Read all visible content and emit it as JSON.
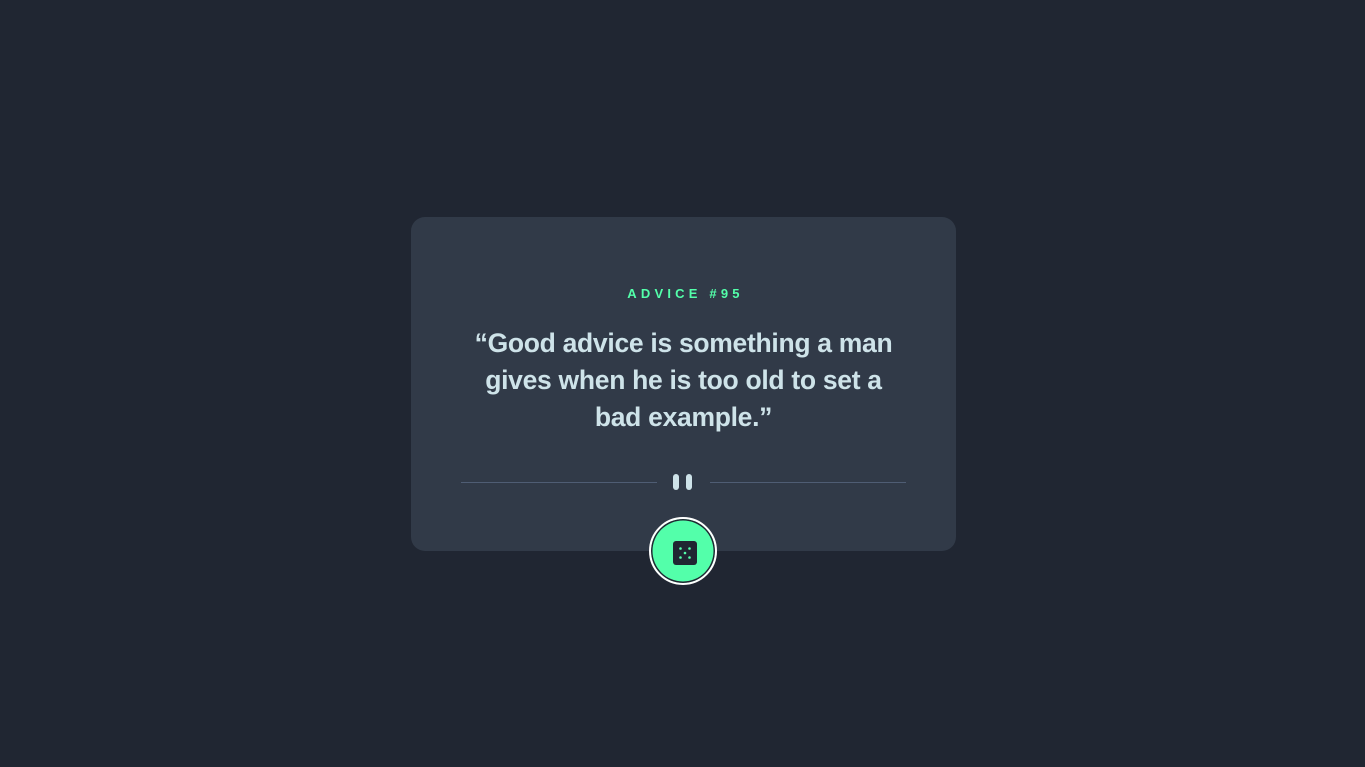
{
  "card": {
    "advice_id": "ADVICE #95",
    "quote": "“Good advice is something a man gives when he is too old to set a bad example.”"
  },
  "divider": {
    "icon": "pause-quote-icon"
  },
  "button": {
    "icon": "dice-icon"
  },
  "colors": {
    "background": "#202632",
    "card": "#313A48",
    "accent": "#53FFAA",
    "text": "#CEE3E9",
    "divider": "#4F5D74"
  }
}
